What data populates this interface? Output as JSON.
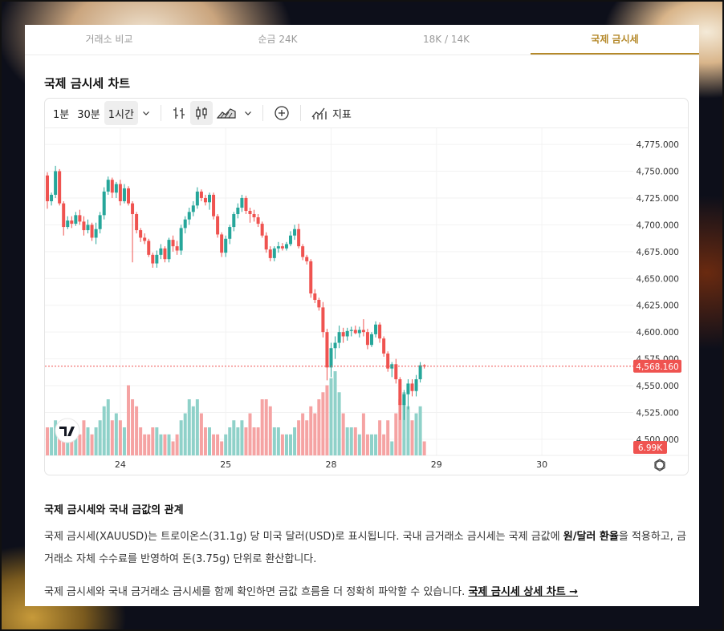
{
  "tabs": [
    "거래소 비교",
    "순금 24K",
    "18K / 14K",
    "국제 금시세"
  ],
  "active_tab": 3,
  "section_title": "국제 금시세 차트",
  "toolbar": {
    "interval_1m": "1분",
    "interval_30m": "30분",
    "interval_1h": "1시간",
    "indicators_label": "지표",
    "icons": [
      "chevron-down-icon",
      "bar-style-icon",
      "candle-style-icon",
      "area-style-icon",
      "chevron-down-icon",
      "add-compare-icon",
      "indicators-icon"
    ]
  },
  "chart_data": {
    "type": "candlestick",
    "yticks": [
      "4,775.000",
      "4,750.000",
      "4,725.000",
      "4,700.000",
      "4,675.000",
      "4,650.000",
      "4,625.000",
      "4,600.000",
      "4,575.000",
      "4,550.000",
      "4,525.000",
      "4,500.000"
    ],
    "ylim": [
      4485,
      4790
    ],
    "xticks": [
      {
        "label": "24",
        "bar": 18
      },
      {
        "label": "25",
        "bar": 44
      },
      {
        "label": "28",
        "bar": 70
      },
      {
        "label": "29",
        "bar": 96
      },
      {
        "label": "30",
        "bar": 122
      }
    ],
    "last_price": 4568.16,
    "last_price_label": "4,568.160",
    "volume_label": "6.99K",
    "up_color": "#26a69a",
    "down_color": "#ef5350",
    "up_volume_color": "#8fd1c9",
    "down_volume_color": "#f5a3a3",
    "candles": [
      [
        4746,
        4749,
        4715,
        4722,
        4
      ],
      [
        4722,
        4730,
        4718,
        4728,
        4
      ],
      [
        4728,
        4755,
        4725,
        4750,
        5
      ],
      [
        4750,
        4752,
        4718,
        4720,
        4
      ],
      [
        4720,
        4722,
        4690,
        4698,
        3
      ],
      [
        4698,
        4708,
        4696,
        4704,
        3
      ],
      [
        4704,
        4708,
        4697,
        4701,
        2
      ],
      [
        4701,
        4712,
        4699,
        4709,
        3
      ],
      [
        4709,
        4714,
        4700,
        4703,
        3
      ],
      [
        4703,
        4708,
        4690,
        4695,
        5
      ],
      [
        4695,
        4705,
        4692,
        4700,
        4
      ],
      [
        4700,
        4702,
        4685,
        4688,
        3
      ],
      [
        4688,
        4702,
        4682,
        4696,
        4
      ],
      [
        4696,
        4712,
        4692,
        4709,
        5
      ],
      [
        4709,
        4735,
        4705,
        4731,
        7
      ],
      [
        4731,
        4745,
        4728,
        4742,
        8
      ],
      [
        4742,
        4744,
        4725,
        4730,
        5
      ],
      [
        4730,
        4740,
        4725,
        4738,
        6
      ],
      [
        4738,
        4742,
        4718,
        4722,
        5
      ],
      [
        4722,
        4738,
        4720,
        4734,
        4
      ],
      [
        4734,
        4736,
        4718,
        4720,
        10
      ],
      [
        4720,
        4722,
        4665,
        4710,
        8
      ],
      [
        4710,
        4712,
        4692,
        4695,
        7
      ],
      [
        4695,
        4697,
        4684,
        4688,
        4
      ],
      [
        4688,
        4692,
        4682,
        4685,
        3
      ],
      [
        4685,
        4687,
        4670,
        4672,
        3
      ],
      [
        4672,
        4674,
        4660,
        4664,
        4
      ],
      [
        4664,
        4676,
        4660,
        4672,
        4
      ],
      [
        4672,
        4682,
        4668,
        4678,
        3
      ],
      [
        4678,
        4680,
        4665,
        4668,
        3
      ],
      [
        4668,
        4688,
        4665,
        4686,
        3
      ],
      [
        4686,
        4690,
        4675,
        4680,
        2
      ],
      [
        4680,
        4685,
        4672,
        4676,
        3
      ],
      [
        4676,
        4700,
        4672,
        4697,
        5
      ],
      [
        4697,
        4708,
        4692,
        4705,
        6
      ],
      [
        4705,
        4716,
        4700,
        4712,
        8
      ],
      [
        4712,
        4722,
        4708,
        4718,
        7
      ],
      [
        4718,
        4735,
        4715,
        4731,
        8
      ],
      [
        4731,
        4733,
        4722,
        4725,
        6
      ],
      [
        4725,
        4728,
        4718,
        4721,
        4
      ],
      [
        4721,
        4730,
        4714,
        4728,
        4
      ],
      [
        4728,
        4730,
        4705,
        4708,
        3
      ],
      [
        4708,
        4710,
        4688,
        4691,
        3
      ],
      [
        4691,
        4693,
        4670,
        4674,
        2
      ],
      [
        4674,
        4690,
        4670,
        4687,
        3
      ],
      [
        4687,
        4700,
        4682,
        4698,
        4
      ],
      [
        4698,
        4712,
        4694,
        4710,
        5
      ],
      [
        4710,
        4720,
        4706,
        4716,
        4
      ],
      [
        4716,
        4728,
        4712,
        4725,
        5
      ],
      [
        4725,
        4727,
        4710,
        4713,
        4
      ],
      [
        4713,
        4716,
        4702,
        4710,
        6
      ],
      [
        4710,
        4714,
        4703,
        4707,
        4
      ],
      [
        4707,
        4710,
        4698,
        4701,
        4
      ],
      [
        4701,
        4703,
        4688,
        4690,
        8
      ],
      [
        4690,
        4693,
        4674,
        4677,
        8
      ],
      [
        4677,
        4680,
        4666,
        4669,
        7
      ],
      [
        4669,
        4680,
        4666,
        4678,
        4
      ],
      [
        4678,
        4684,
        4674,
        4680,
        4
      ],
      [
        4680,
        4683,
        4676,
        4678,
        3
      ],
      [
        4678,
        4684,
        4676,
        4682,
        3
      ],
      [
        4682,
        4694,
        4680,
        4690,
        3
      ],
      [
        4690,
        4700,
        4686,
        4696,
        4
      ],
      [
        4696,
        4701,
        4678,
        4680,
        5
      ],
      [
        4680,
        4682,
        4667,
        4670,
        6
      ],
      [
        4670,
        4672,
        4663,
        4666,
        5
      ],
      [
        4666,
        4668,
        4632,
        4636,
        7
      ],
      [
        4636,
        4640,
        4627,
        4630,
        6
      ],
      [
        4630,
        4632,
        4620,
        4623,
        8
      ],
      [
        4623,
        4628,
        4595,
        4600,
        9
      ],
      [
        4600,
        4603,
        4555,
        4567,
        10
      ],
      [
        4567,
        4590,
        4558,
        4585,
        11
      ],
      [
        4585,
        4596,
        4575,
        4590,
        12
      ],
      [
        4590,
        4606,
        4585,
        4600,
        9
      ],
      [
        4600,
        4604,
        4590,
        4596,
        6
      ],
      [
        4596,
        4604,
        4592,
        4601,
        4
      ],
      [
        4601,
        4605,
        4596,
        4602,
        4
      ],
      [
        4602,
        4606,
        4598,
        4599,
        4
      ],
      [
        4599,
        4605,
        4595,
        4602,
        3
      ],
      [
        4602,
        4612,
        4596,
        4600,
        6
      ],
      [
        4600,
        4603,
        4584,
        4588,
        3
      ],
      [
        4588,
        4600,
        4586,
        4598,
        3
      ],
      [
        4598,
        4610,
        4595,
        4607,
        3
      ],
      [
        4607,
        4609,
        4590,
        4594,
        5
      ],
      [
        4594,
        4596,
        4577,
        4580,
        3
      ],
      [
        4580,
        4582,
        4563,
        4566,
        5
      ],
      [
        4566,
        4572,
        4558,
        4570,
        2
      ],
      [
        4570,
        4575,
        4552,
        4556,
        6
      ],
      [
        4556,
        4558,
        4518,
        4532,
        8
      ],
      [
        4532,
        4546,
        4518,
        4542,
        9
      ],
      [
        4542,
        4556,
        4528,
        4552,
        7
      ],
      [
        4552,
        4556,
        4540,
        4545,
        5
      ],
      [
        4545,
        4560,
        4540,
        4556,
        6
      ],
      [
        4556,
        4572,
        4553,
        4569,
        7
      ],
      [
        4569,
        4570,
        4566,
        4568,
        2
      ]
    ]
  },
  "info_heading": "국제 금시세와 국내 금값의 관계",
  "para1": {
    "part1": "국제 금시세(XAUUSD)는 트로이온스(31.1g) 당 미국 달러(USD)로 표시됩니다. 국내 금거래소 금시세는 국제 금값에 ",
    "bold": "원/달러 환율",
    "part2": "을 적용하고, 금거래소 자체 수수료를 반영하여 돈(3.75g) 단위로 환산합니다."
  },
  "para2": {
    "text": "국제 금시세와 국내 금거래소 금시세를 함께 확인하면 금값 흐름을 더 정확히 파악할 수 있습니다. ",
    "link": "국제 금시세 상세 차트 →"
  }
}
